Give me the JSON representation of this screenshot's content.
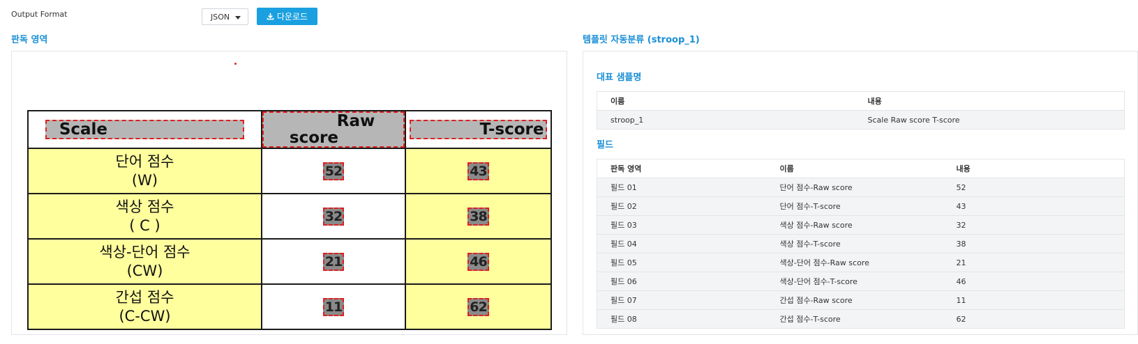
{
  "toolbar": {
    "output_format_label": "Output Format",
    "format_value": "JSON",
    "download_label": "다운로드"
  },
  "left": {
    "title": "판독 영역",
    "doc_table": {
      "headers": [
        "Scale",
        "Raw score",
        "T-score"
      ],
      "rows": [
        {
          "scale_line1": "단어 점수",
          "scale_line2": "(W)",
          "raw": "52",
          "t": "43"
        },
        {
          "scale_line1": "색상 점수",
          "scale_line2": "( C )",
          "raw": "32",
          "t": "38"
        },
        {
          "scale_line1": "색상-단어 점수",
          "scale_line2": "(CW)",
          "raw": "21",
          "t": "46"
        },
        {
          "scale_line1": "간섭 점수",
          "scale_line2": "(C-CW)",
          "raw": "11",
          "t": "62"
        }
      ]
    }
  },
  "right": {
    "title": "템플릿 자동분류 (stroop_1)",
    "sample_title": "대표 샘플명",
    "sample_headers": [
      "이름",
      "내용"
    ],
    "sample_rows": [
      {
        "name": "stroop_1",
        "content": "Scale Raw score T-score"
      }
    ],
    "fields_title": "필드",
    "fields_headers": [
      "판독 영역",
      "이름",
      "내용"
    ],
    "fields_rows": [
      {
        "area": "필드 01",
        "name": "단어 점수-Raw score",
        "value": "52"
      },
      {
        "area": "필드 02",
        "name": "단어 점수-T-score",
        "value": "43"
      },
      {
        "area": "필드 03",
        "name": "색상 점수-Raw score",
        "value": "32"
      },
      {
        "area": "필드 04",
        "name": "색상 점수-T-score",
        "value": "38"
      },
      {
        "area": "필드 05",
        "name": "색상-단어 점수-Raw score",
        "value": "21"
      },
      {
        "area": "필드 06",
        "name": "색상-단어 점수-T-score",
        "value": "46"
      },
      {
        "area": "필드 07",
        "name": "간섭 점수-Raw score",
        "value": "11"
      },
      {
        "area": "필드 08",
        "name": "간섭 점수-T-score",
        "value": "62"
      }
    ]
  },
  "colors": {
    "accent": "#1a8fd6",
    "button": "#1aa0e0",
    "highlight_yellow": "#ffff9e",
    "ocr_box": "#e01e1e"
  }
}
